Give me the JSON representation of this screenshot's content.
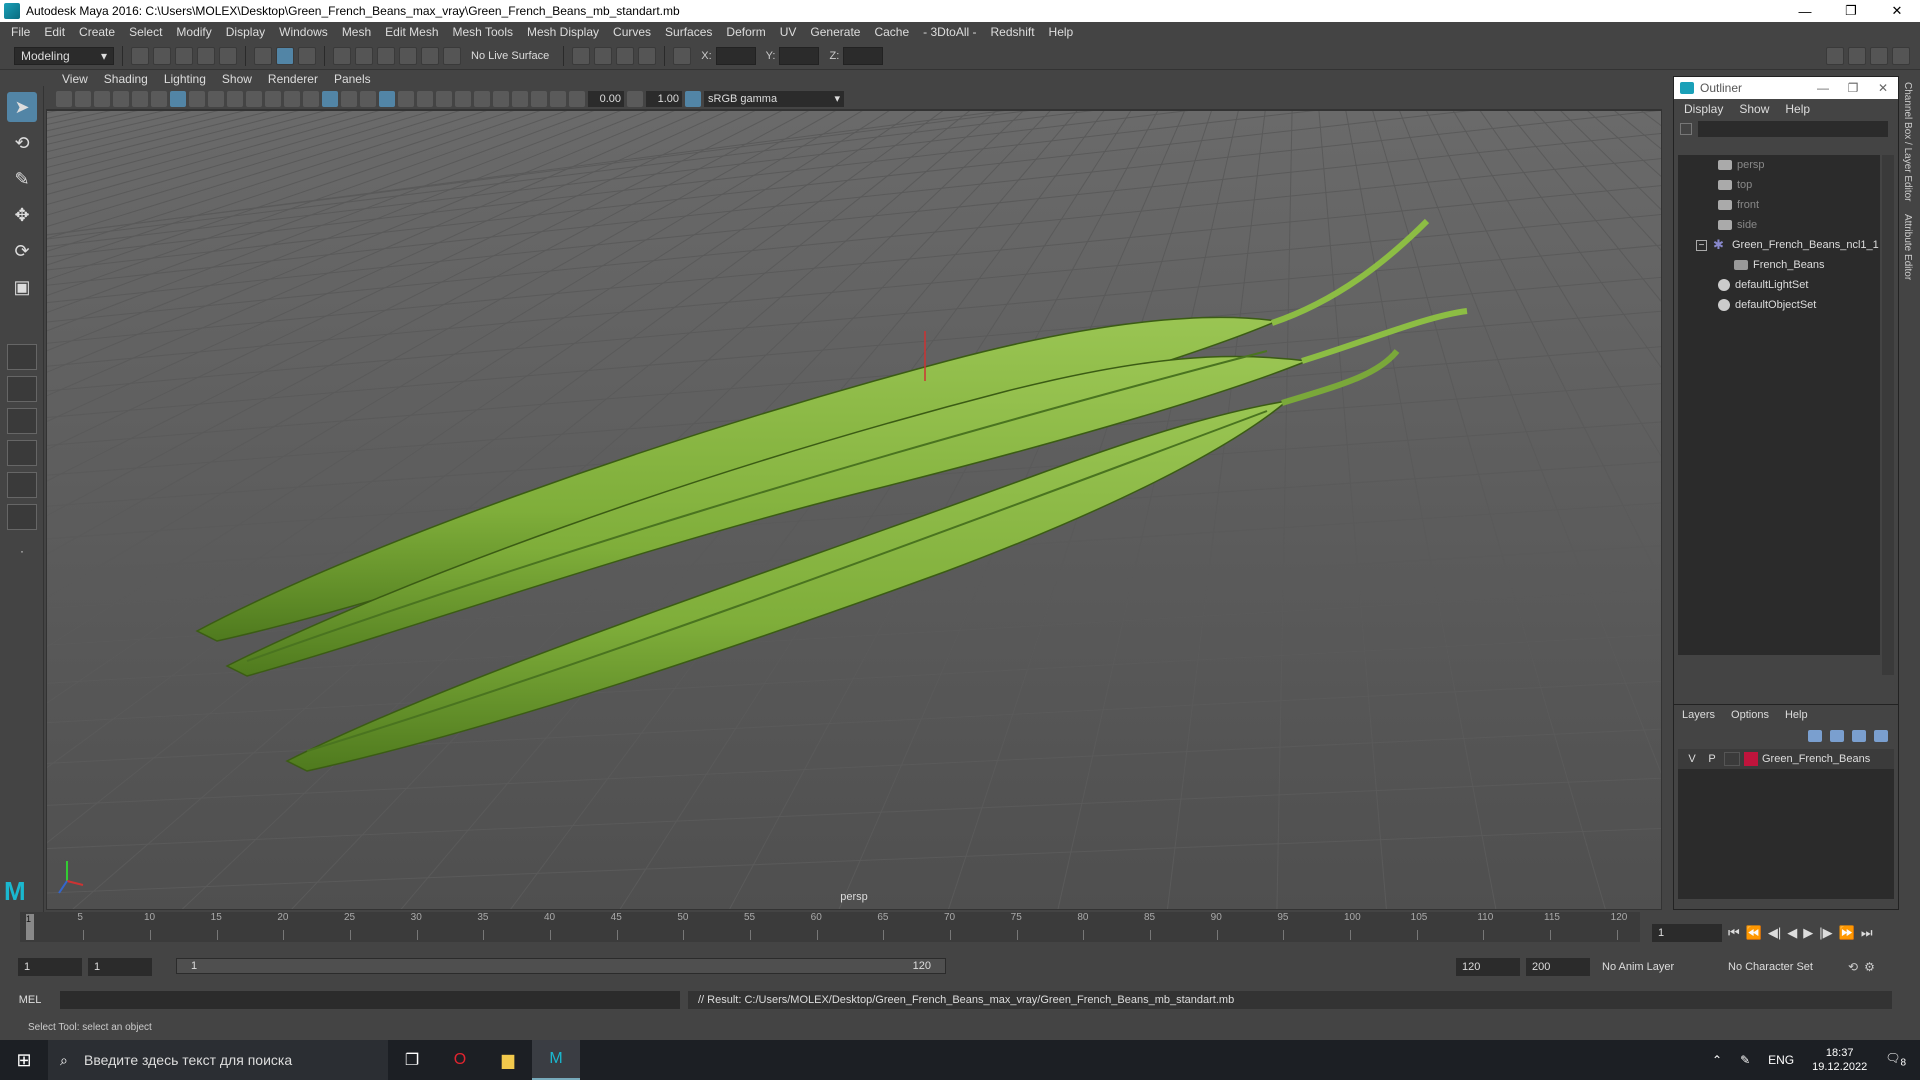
{
  "window": {
    "title": "Autodesk Maya 2016: C:\\Users\\MOLEX\\Desktop\\Green_French_Beans_max_vray\\Green_French_Beans_mb_standart.mb",
    "min": "—",
    "max": "❐",
    "close": "✕"
  },
  "menus": [
    "File",
    "Edit",
    "Create",
    "Select",
    "Modify",
    "Display",
    "Windows",
    "Mesh",
    "Edit Mesh",
    "Mesh Tools",
    "Mesh Display",
    "Curves",
    "Surfaces",
    "Deform",
    "UV",
    "Generate",
    "Cache",
    "- 3DtoAll -",
    "Redshift",
    "Help"
  ],
  "statusline": {
    "mode": "Modeling",
    "live_surface": "No Live Surface",
    "x_label": "X:",
    "y_label": "Y:",
    "z_label": "Z:"
  },
  "panel": {
    "menus": [
      "View",
      "Shading",
      "Lighting",
      "Show",
      "Renderer",
      "Panels"
    ],
    "exposure": "0.00",
    "gamma": "1.00",
    "color_space": "sRGB gamma",
    "camera": "persp"
  },
  "outliner": {
    "title": "Outliner",
    "menus": [
      "Display",
      "Show",
      "Help"
    ],
    "items": [
      {
        "label": "persp",
        "type": "camera",
        "dim": true
      },
      {
        "label": "top",
        "type": "camera",
        "dim": true
      },
      {
        "label": "front",
        "type": "camera",
        "dim": true
      },
      {
        "label": "side",
        "type": "camera",
        "dim": true
      },
      {
        "label": "Green_French_Beans_ncl1_1",
        "type": "group",
        "expanded": "−"
      },
      {
        "label": "French_Beans",
        "type": "mesh"
      },
      {
        "label": "defaultLightSet",
        "type": "set"
      },
      {
        "label": "defaultObjectSet",
        "type": "set"
      }
    ]
  },
  "layers": {
    "menus": [
      "Layers",
      "Options",
      "Help"
    ],
    "rows": [
      {
        "v": "V",
        "p": "P",
        "name": "Green_French_Beans",
        "color": "#c0143c"
      }
    ]
  },
  "sidetabs": [
    "Channel Box / Layer Editor",
    "Attribute Editor"
  ],
  "timeline": {
    "ticks": [
      "5",
      "10",
      "15",
      "20",
      "25",
      "30",
      "35",
      "40",
      "45",
      "50",
      "55",
      "60",
      "65",
      "70",
      "75",
      "80",
      "85",
      "90",
      "95",
      "100",
      "105",
      "110",
      "115",
      "120"
    ],
    "current": "1",
    "current_field": "1"
  },
  "range": {
    "start": "1",
    "playback_start": "1",
    "slider_start": "1",
    "slider_end": "120",
    "playback_end": "120",
    "end": "200",
    "anim_layer": "No Anim Layer",
    "char_set": "No Character Set"
  },
  "command": {
    "label": "MEL",
    "result": "// Result: C:/Users/MOLEX/Desktop/Green_French_Beans_max_vray/Green_French_Beans_mb_standart.mb"
  },
  "help_line": "Select Tool: select an object",
  "taskbar": {
    "search_placeholder": "Введите здесь текст для поиска",
    "lang": "ENG",
    "time": "18:37",
    "date": "19.12.2022",
    "notif": "8"
  },
  "colors": {
    "bean": "#7fae3a",
    "bean_dark": "#4f7a1e",
    "accent": "#5285a6"
  }
}
